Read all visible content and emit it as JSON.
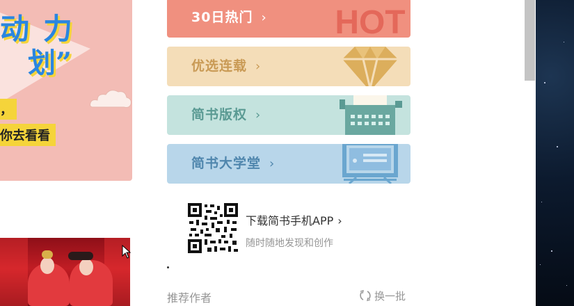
{
  "banner": {
    "line1": "动力",
    "line2": "划”",
    "line3": "，",
    "line4": "你去看看"
  },
  "menu": {
    "hot_label": "30日热门",
    "hot_badge": "HOT",
    "serial_label": "优选连载",
    "copyright_label": "简书版权",
    "university_label": "简书大学堂",
    "chevron": "›"
  },
  "app_download": {
    "title": "下载简书手机APP",
    "chevron": "›",
    "subtitle": "随时随地发现和创作"
  },
  "recommend": {
    "title": "推荐作者",
    "refresh_label": "换一批"
  },
  "colors": {
    "hot": "#f0907f",
    "serial": "#f4ddb8",
    "copyright": "#c4e3de",
    "university": "#b8d6ea"
  },
  "icons": [
    "hot-text-icon",
    "diamond-icon",
    "typewriter-icon",
    "monitor-icon",
    "qr-code-icon",
    "refresh-icon",
    "cursor-icon"
  ]
}
